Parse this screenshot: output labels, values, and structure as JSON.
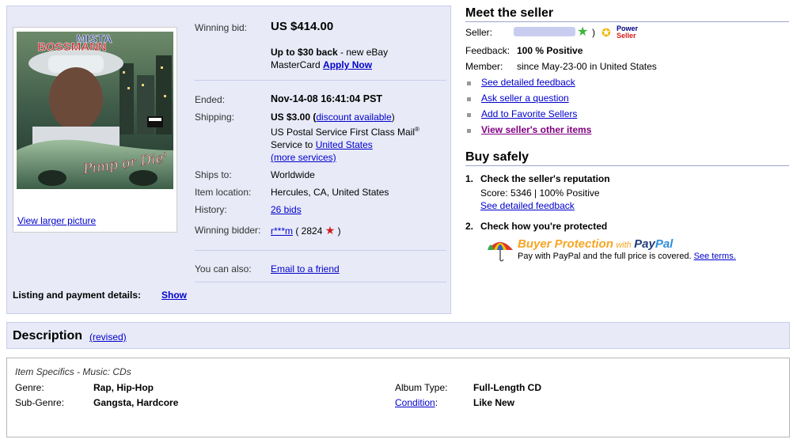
{
  "item": {
    "cover_top_text": "MISTA",
    "cover_name_text": "BOSSMANN",
    "cover_title_text": "Pimp or Die'",
    "view_larger": "View larger picture",
    "winning_bid_label": "Winning bid:",
    "winning_bid_value": "US $414.00",
    "promo_line1": "Up to $30 back",
    "promo_line1_rest": " - new eBay",
    "promo_line2": "MasterCard ",
    "promo_apply": "Apply Now",
    "ended_label": "Ended:",
    "ended_value": "Nov-14-08 16:41:04 PST",
    "shipping_label": "Shipping:",
    "shipping_value": "US $3.00 (",
    "shipping_discount": "discount available",
    "shipping_close": ")",
    "shipping_service": "US Postal Service First Class Mail",
    "shipping_service_sup": "®",
    "shipping_service2": "Service to ",
    "shipping_country": "United States",
    "shipping_more": "(more services)",
    "ships_to_label": "Ships to:",
    "ships_to_value": "Worldwide",
    "location_label": "Item location:",
    "location_value": "Hercules, CA, United States",
    "history_label": "History:",
    "history_value": "26 bids",
    "winner_label": "Winning bidder:",
    "winner_name": "r***m",
    "winner_score_open": " ( 2824 ",
    "winner_score_close": " )",
    "also_label": "You can also:",
    "also_value": "Email to a friend",
    "listing_label": "Listing and payment details:",
    "listing_show": "Show"
  },
  "seller": {
    "heading": "Meet the seller",
    "seller_label": "Seller:",
    "seller_close": ")",
    "power_seller_line1": "Power",
    "power_seller_line2": "Seller",
    "feedback_label": "Feedback:",
    "feedback_value": "100 % Positive",
    "member_label": "Member:",
    "member_value": "since May-23-00 in United States",
    "links": [
      "See detailed feedback",
      "Ask seller a question",
      "Add to Favorite Sellers",
      "View seller's other items"
    ]
  },
  "buy_safely": {
    "heading": "Buy safely",
    "step1_num": "1.",
    "step1_title": "Check the seller's reputation",
    "step1_score": "Score: 5346 | 100% Positive",
    "step1_link": "See detailed feedback",
    "step2_num": "2.",
    "step2_title": "Check how you're protected",
    "bp_text": "Buyer Protection",
    "bp_with": "with",
    "bp_paypal_pay": "Pay",
    "bp_paypal_pal": "Pal",
    "bp_desc": "Pay with PayPal and the full price is covered.",
    "bp_terms": "See terms."
  },
  "description": {
    "heading": "Description",
    "revised": "(revised)",
    "specifics_title": "Item Specifics - Music: CDs",
    "genre_label": "Genre:",
    "genre_value": "Rap, Hip-Hop",
    "subgenre_label": "Sub-Genre:",
    "subgenre_value": "Gangsta, Hardcore",
    "album_label": "Album Type:",
    "album_value": "Full-Length CD",
    "condition_label": "Condition",
    "condition_colon": ":",
    "condition_value": "Like New"
  },
  "colors": {
    "link": "#0000cc",
    "visited_link": "#800080",
    "panel_bg": "#e8eaf7",
    "buyer_protection": "#f5a623",
    "paypal_blue": "#1f3d7a"
  }
}
